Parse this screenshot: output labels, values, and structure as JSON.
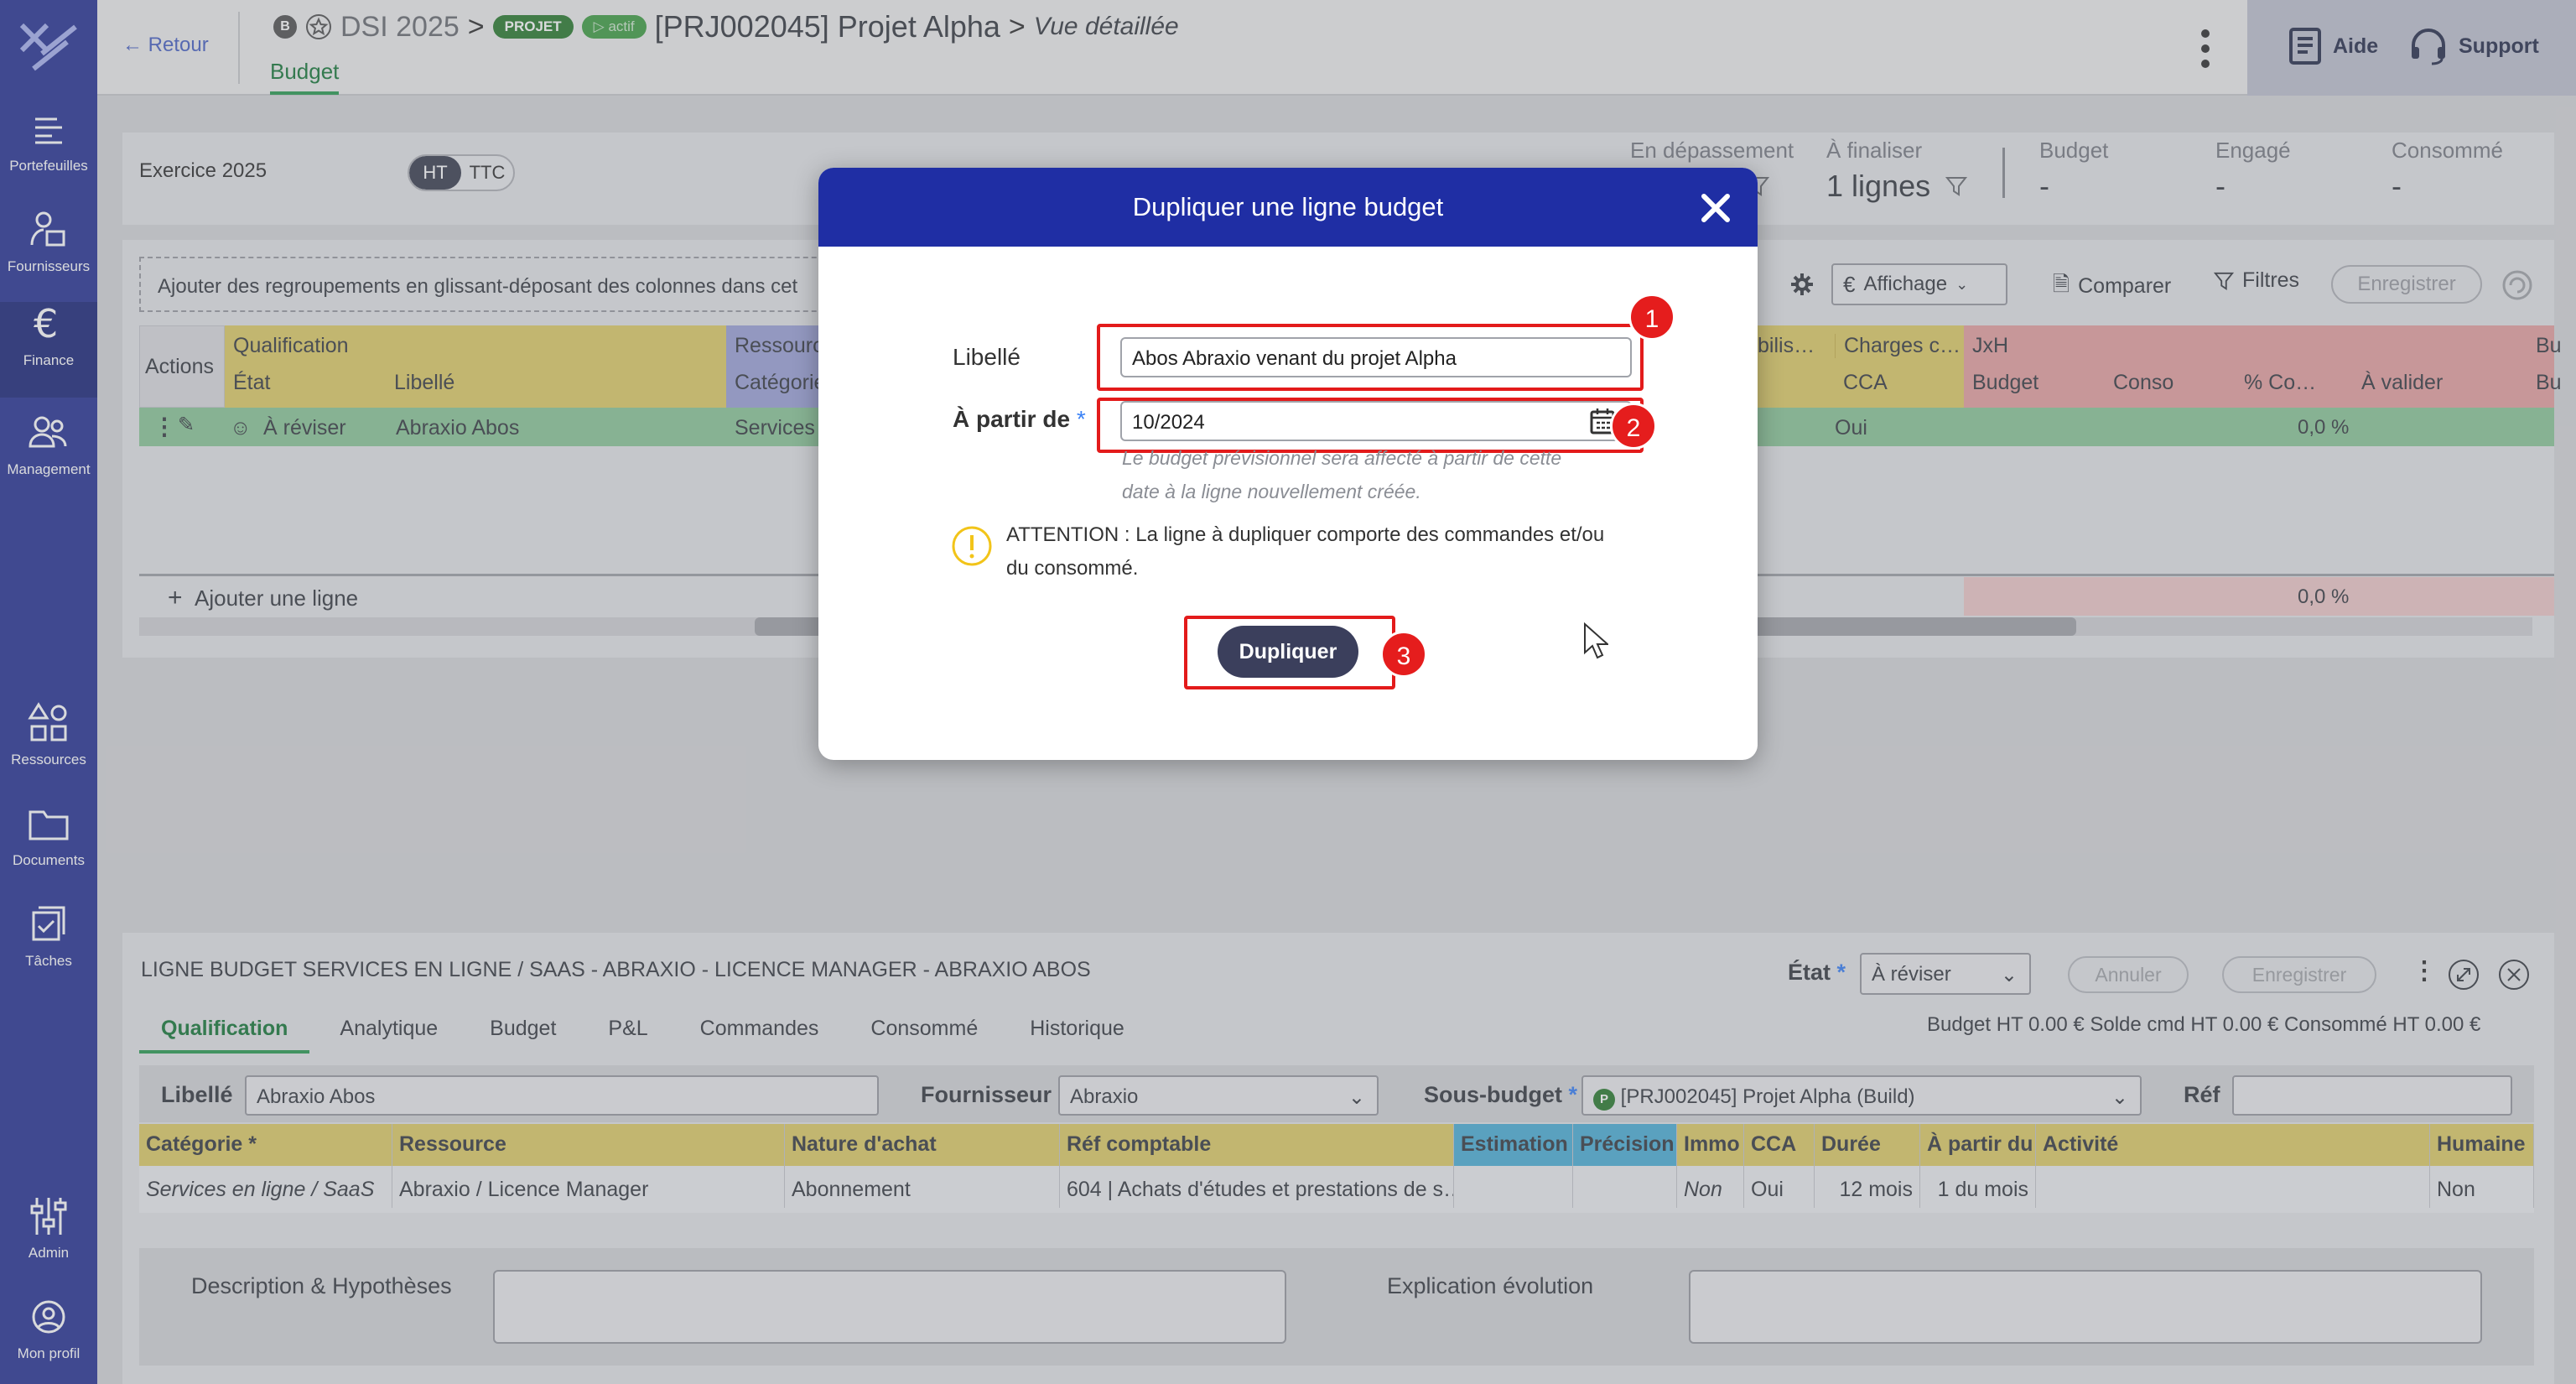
{
  "sidebar": {
    "items": [
      {
        "label": "Portefeuilles",
        "icon": "portfolio-icon"
      },
      {
        "label": "Fournisseurs",
        "icon": "suppliers-icon"
      },
      {
        "label": "Finance",
        "icon": "euro-icon"
      },
      {
        "label": "Management",
        "icon": "people-icon"
      },
      {
        "label": "Ressources",
        "icon": "shapes-icon"
      },
      {
        "label": "Documents",
        "icon": "folder-icon"
      },
      {
        "label": "Tâches",
        "icon": "tasks-icon"
      },
      {
        "label": "Admin",
        "icon": "sliders-icon"
      },
      {
        "label": "Mon profil",
        "icon": "user-icon"
      }
    ]
  },
  "header": {
    "back": "← Retour",
    "badge_b": "B",
    "program": "DSI 2025",
    "badge_projet": "PROJET",
    "badge_actif": "▷ actif",
    "project": "[PRJ002045] Projet Alpha",
    "view": "Vue détaillée",
    "tab": "Budget",
    "aide": "Aide",
    "support": "Support"
  },
  "top": {
    "exercice": "Exercice 2025",
    "ht": "HT",
    "ttc": "TTC",
    "kpis": [
      {
        "label": "En dépassement",
        "value": ""
      },
      {
        "label": "À finaliser",
        "value": "1 lignes"
      },
      {
        "label": "Budget",
        "value": "-"
      },
      {
        "label": "Engagé",
        "value": "-"
      },
      {
        "label": "Consommé",
        "value": "-"
      }
    ]
  },
  "grid": {
    "group_hint": "Ajouter des regroupements en glissant-déposant des colonnes dans cet",
    "affichage": "Affichage",
    "comparer": "Comparer",
    "filtres": "Filtres",
    "enregistrer": "Enregistrer",
    "actions": "Actions",
    "qualification": "Qualification",
    "etat": "État",
    "libelle": "Libellé",
    "ressource": "Ressourc",
    "categorie": "Catégorie",
    "mobilis": "bilis…",
    "charges": "Charges c…",
    "cca": "CCA",
    "jxh": "JxH",
    "budget": "Budget",
    "conso": "Conso",
    "pct_co": "% Co…",
    "a_valider": "À valider",
    "bu": "Bu",
    "row": {
      "etat": "À réviser",
      "libelle": "Abraxio Abos",
      "categorie": "Services e",
      "cca": "Oui",
      "pct": "0,0 %"
    },
    "add_line": "Ajouter une ligne",
    "total_pct": "0,0 %"
  },
  "modal": {
    "title": "Dupliquer une ligne budget",
    "libelle_label": "Libellé",
    "libelle_value": "Abos Abraxio venant du projet Alpha",
    "apartir_label": "À partir de",
    "required": "*",
    "apartir_value": "10/2024",
    "hint1": "Le budget prévisionnel sera affecté à partir de cette",
    "hint2": "date à la ligne nouvellement créée.",
    "warn1": "ATTENTION : La ligne à dupliquer comporte des commandes et/ou",
    "warn2": "du consommé.",
    "button": "Dupliquer",
    "steps": [
      "1",
      "2",
      "3"
    ]
  },
  "detail": {
    "title": "LIGNE BUDGET   SERVICES EN LIGNE / SAAS - ABRAXIO - LICENCE MANAGER - ABRAXIO ABOS",
    "etat_label": "État",
    "etat_value": "À réviser",
    "annuler": "Annuler",
    "enregistrer": "Enregistrer",
    "tabs": [
      "Qualification",
      "Analytique",
      "Budget",
      "P&L",
      "Commandes",
      "Consommé",
      "Historique"
    ],
    "totals": "Budget HT 0.00 €    Solde cmd HT 0.00 €    Consommé HT 0.00 €",
    "libelle_label": "Libellé",
    "libelle_value": "Abraxio Abos",
    "fournisseur_label": "Fournisseur",
    "fournisseur_value": "Abraxio",
    "sousbudget_label": "Sous-budget",
    "sousbudget_badge": "P",
    "sousbudget_value": "[PRJ002045] Projet Alpha (Build)",
    "ref_label": "Réf",
    "cols": [
      "Catégorie *",
      "Ressource",
      "Nature d'achat",
      "Réf comptable",
      "Estimation",
      "Précision",
      "Immo",
      "CCA",
      "Durée",
      "À partir du",
      "Activité",
      "Humaine"
    ],
    "row": [
      "Services en ligne / SaaS",
      "Abraxio / Licence Manager",
      "Abonnement",
      "604 | Achats d'études et prestations de s…",
      "",
      "",
      "Non",
      "Oui",
      "12 mois",
      "1 du mois",
      "",
      "Non"
    ],
    "desc_label": "Description & Hypothèses",
    "expl_label": "Explication évolution"
  }
}
